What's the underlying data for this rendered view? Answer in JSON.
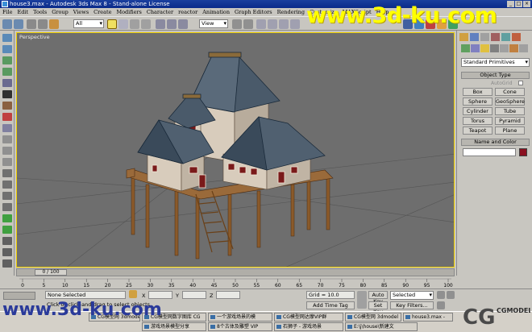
{
  "window": {
    "title": "house3.max - Autodesk 3ds Max 8 - Stand-alone License"
  },
  "menu": [
    "File",
    "Edit",
    "Tools",
    "Group",
    "Views",
    "Create",
    "Modifiers",
    "Character",
    "reactor",
    "Animation",
    "Graph Editors",
    "Rendering",
    "Customize",
    "MAXScript",
    "Help"
  ],
  "toolbar": {
    "selection_filter": "All",
    "reference_coord": "View"
  },
  "viewport": {
    "label": "Perspective"
  },
  "command_panel": {
    "category": "Standard Primitives",
    "object_type_header": "Object Type",
    "autogrid_label": "AutoGrid",
    "buttons": [
      "Box",
      "Cone",
      "Sphere",
      "GeoSphere",
      "Cylinder",
      "Tube",
      "Torus",
      "Pyramid",
      "Teapot",
      "Plane"
    ],
    "name_color_header": "Name and Color"
  },
  "timeline": {
    "frame_indicator": "0 / 100",
    "ticks": [
      "0",
      "5",
      "10",
      "15",
      "20",
      "25",
      "30",
      "35",
      "40",
      "45",
      "50",
      "55",
      "60",
      "65",
      "70",
      "75",
      "80",
      "85",
      "90",
      "95",
      "100"
    ]
  },
  "status": {
    "selection": "None Selected",
    "prompt": "Click or click-and-drag to select objects",
    "grid": "Grid = 10.0",
    "add_time_tag": "Add Time Tag",
    "auto_key": "Auto Key",
    "set_key": "Set Key",
    "key_mode": "Selected",
    "key_filters": "Key Filters..."
  },
  "taskbar": {
    "row1": [
      "CG模型网 3dmodel",
      "CG模型网数字图库 CG",
      "一个游戏场景的模",
      "CG模型网达摩VIP群",
      "CG模型网 3dmodel",
      "house3.max -"
    ],
    "row2": [
      "游戏场景模型分享",
      "8个古体及雕塑 VIP",
      "石狮子 - 游戏场景",
      "E:\\j\\house\\新建文"
    ]
  },
  "watermarks": {
    "top": "www.3d-ku.com",
    "bottom": "www.3d-ku.com",
    "logo": "CGMODEL"
  },
  "colors": {
    "title_bar": "#0a2a8a",
    "viewport_bg": "#6e6e6e",
    "active_border": "#f0d000",
    "watermark": "#ffff00",
    "color_swatch": "#8a1020"
  }
}
